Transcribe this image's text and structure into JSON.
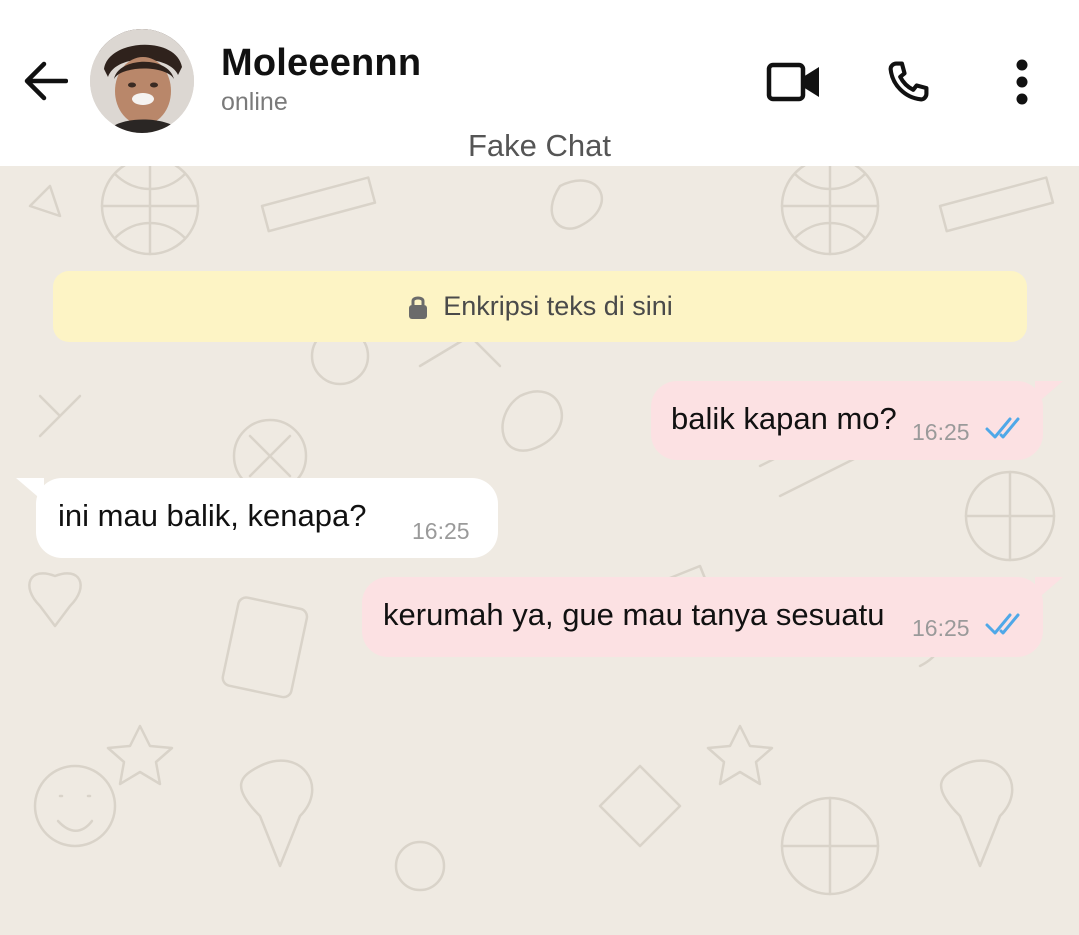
{
  "header": {
    "contact_name": "Moleeennn",
    "status": "online",
    "subtitle": "Fake Chat",
    "icons": [
      "back-arrow-icon",
      "video-call-icon",
      "phone-icon",
      "more-options-icon"
    ]
  },
  "encryption_notice": "Enkripsi teks di sini",
  "messages": [
    {
      "direction": "outgoing",
      "text": "balik kapan mo?",
      "time": "16:25",
      "read": true
    },
    {
      "direction": "incoming",
      "text": "ini mau balik, kenapa?",
      "time": "16:25"
    },
    {
      "direction": "outgoing",
      "text": "kerumah ya, gue mau tanya sesuatu",
      "time": "16:25",
      "read": true
    }
  ],
  "colors": {
    "chat_background": "#efeae2",
    "outgoing_bubble": "#fce1e3",
    "incoming_bubble": "#ffffff",
    "encryption_banner": "#fdf4c5",
    "read_ticks": "#4fa8e8"
  }
}
